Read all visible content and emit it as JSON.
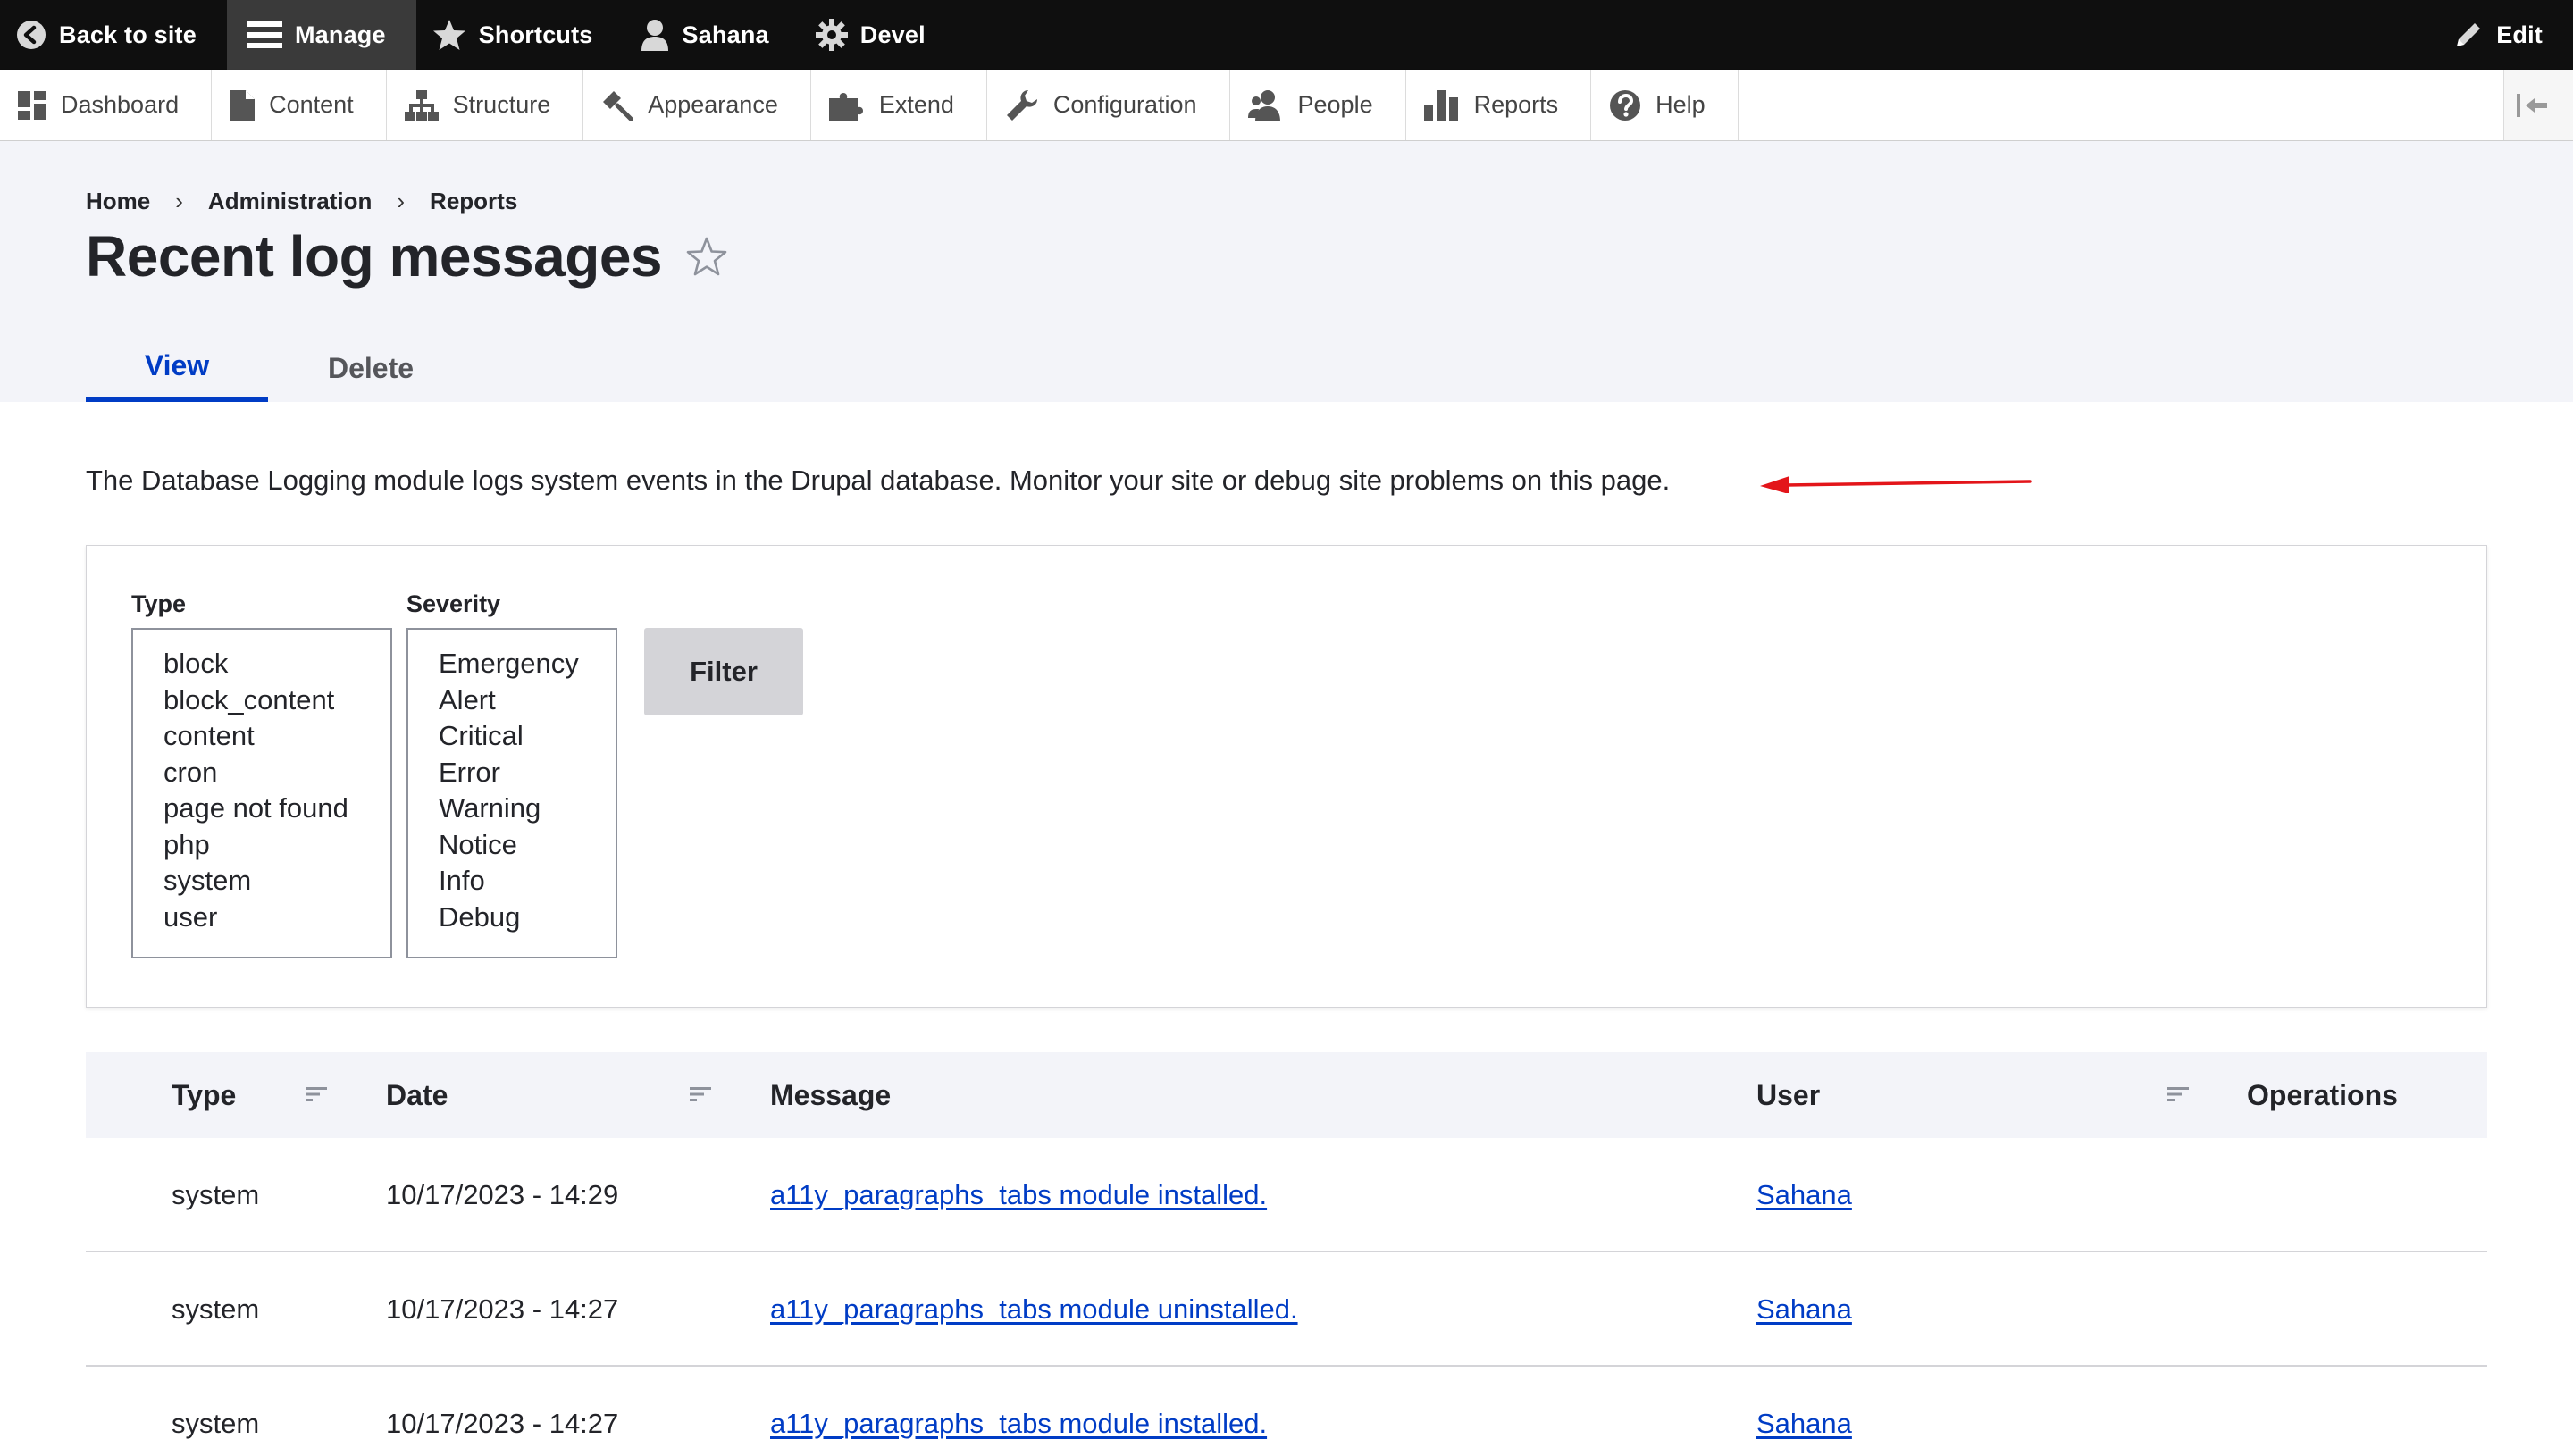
{
  "toolbar": {
    "back_to_site": "Back to site",
    "manage": "Manage",
    "shortcuts": "Shortcuts",
    "user": "Sahana",
    "devel": "Devel",
    "edit": "Edit"
  },
  "tray": {
    "items": [
      "Dashboard",
      "Content",
      "Structure",
      "Appearance",
      "Extend",
      "Configuration",
      "People",
      "Reports",
      "Help"
    ]
  },
  "breadcrumb": [
    "Home",
    "Administration",
    "Reports"
  ],
  "breadcrumb_separator": "›",
  "page": {
    "title": "Recent log messages",
    "tabs": [
      {
        "label": "View",
        "active": true
      },
      {
        "label": "Delete",
        "active": false
      }
    ],
    "description": "The Database Logging module logs system events in the Drupal database. Monitor your site or debug site problems on this page."
  },
  "filter": {
    "type_label": "Type",
    "type_options": [
      "block",
      "block_content",
      "content",
      "cron",
      "page not found",
      "php",
      "system",
      "user"
    ],
    "severity_label": "Severity",
    "severity_options": [
      "Emergency",
      "Alert",
      "Critical",
      "Error",
      "Warning",
      "Notice",
      "Info",
      "Debug"
    ],
    "button": "Filter"
  },
  "table": {
    "headers": {
      "type": "Type",
      "date": "Date",
      "message": "Message",
      "user": "User",
      "operations": "Operations"
    },
    "rows": [
      {
        "type": "system",
        "date": "10/17/2023 - 14:29",
        "message": "a11y_paragraphs_tabs module installed.",
        "user": "Sahana"
      },
      {
        "type": "system",
        "date": "10/17/2023 - 14:27",
        "message": "a11y_paragraphs_tabs module uninstalled.",
        "user": "Sahana"
      },
      {
        "type": "system",
        "date": "10/17/2023 - 14:27",
        "message": "a11y_paragraphs_tabs module installed.",
        "user": "Sahana"
      }
    ]
  },
  "colors": {
    "toolbar_bg": "#0f0f0f",
    "accent_blue": "#003cc5",
    "header_bg": "#f3f4f9",
    "annotation_arrow": "#e3151a"
  },
  "icons": {
    "toolbar": [
      "back-arrow-icon",
      "hamburger-icon",
      "star-icon",
      "user-icon",
      "gear-icon",
      "pencil-icon"
    ],
    "tray": [
      "dashboard-icon",
      "content-icon",
      "structure-icon",
      "appearance-icon",
      "extend-icon",
      "configuration-icon",
      "people-icon",
      "reports-icon",
      "help-icon"
    ]
  }
}
